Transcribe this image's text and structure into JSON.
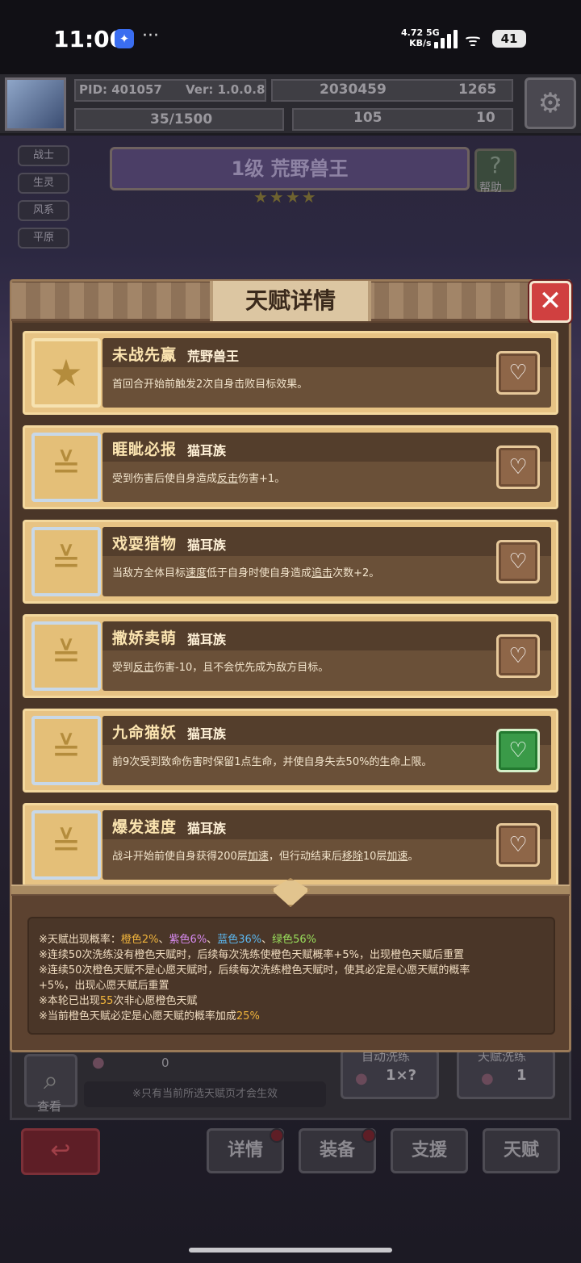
{
  "status_bar": {
    "time": "11:00",
    "app_icon": "ladybug-app-icon",
    "more": "···",
    "net_speed": "4.72",
    "net_unit": "KB/s",
    "net_type": "5G",
    "battery": "41"
  },
  "hud": {
    "pid": "PID: 401057",
    "version": "Ver: 1.0.0.8",
    "gold": "2030459",
    "gems": "1265",
    "energy": "35/1500",
    "clover": "105",
    "keys": "10"
  },
  "side_tags": [
    "战士",
    "生灵",
    "风系",
    "平原"
  ],
  "stage": {
    "title": "1级  荒野兽王",
    "help_label": "帮助",
    "stars": "★★★★"
  },
  "modal": {
    "title": "天赋详情",
    "close": "✕",
    "talents": [
      {
        "name": "未战先赢",
        "source": "荒野兽王",
        "desc_parts": [
          "首回合开始前触发2次自身击败目标效果。"
        ],
        "favorite": false,
        "frame": "orange",
        "icon": "star-icon"
      },
      {
        "name": "睚眦必报",
        "source": "猫耳族",
        "desc_parts": [
          "受到伤害后使自身造成",
          "反击",
          "伤害+1。"
        ],
        "favorite": false,
        "frame": "blue",
        "icon": "cat-icon"
      },
      {
        "name": "戏耍猎物",
        "source": "猫耳族",
        "desc_parts": [
          "当敌方全体目标",
          "速度",
          "低于自身时使自身造成",
          "追击",
          "次数+2。"
        ],
        "favorite": false,
        "frame": "blue",
        "icon": "cat-icon"
      },
      {
        "name": "撒娇卖萌",
        "source": "猫耳族",
        "desc_parts": [
          "受到",
          "反击",
          "伤害-10，且不会优先成为敌方目标。"
        ],
        "favorite": false,
        "frame": "blue",
        "icon": "cat-icon"
      },
      {
        "name": "九命猫妖",
        "source": "猫耳族",
        "desc_parts": [
          "前9次受到致命伤害时保留1点生命，并使自身失去50%的生命上限。"
        ],
        "favorite": true,
        "frame": "blue",
        "icon": "cat-icon"
      },
      {
        "name": "爆发速度",
        "source": "猫耳族",
        "desc_parts": [
          "战斗开始前使自身获得200层",
          "加速",
          "，但行动结束后",
          "移除",
          "10层",
          "加速",
          "。"
        ],
        "favorite": false,
        "frame": "blue",
        "icon": "cat-icon"
      }
    ],
    "info": {
      "line1_prefix": "※天赋出现概率：",
      "orange": "橙色2%",
      "sep": "、",
      "purple": "紫色6%",
      "blue": "蓝色36%",
      "green": "绿色56%",
      "line2": "※连续50次洗练没有橙色天赋时，后续每次洗练使橙色天赋概率+5%，出现橙色天赋后重置",
      "line3a": "※连续50次橙色天赋不是心愿天赋时，后续每次洗练橙色天赋时，使其必定是心愿天赋的概率",
      "line3b": "+5%，出现心愿天赋后重置",
      "line4_prefix": "※本轮已出现",
      "line4_value": "55",
      "line4_suffix": "次非心愿橙色天赋",
      "line5_prefix": "※当前橙色天赋必定是心愿天赋的概率加成",
      "line5_value": "25%"
    }
  },
  "bottom": {
    "search_label": "查看",
    "count": "0",
    "hint": "※只有当前所选天赋页才会生效",
    "auto_wash_label": "自动洗练",
    "auto_wash_value": "1×?",
    "wash_label": "天赋洗练",
    "wash_value": "1",
    "back": "↩",
    "nav": [
      "详情",
      "装备",
      "支援",
      "天赋"
    ]
  },
  "colors": {
    "orange": "#f0b43c",
    "purple": "#d88af0",
    "blue": "#5cb8f0",
    "green": "#9ae05c",
    "close_red": "#d04040",
    "favorite_green": "#3a9a48"
  }
}
